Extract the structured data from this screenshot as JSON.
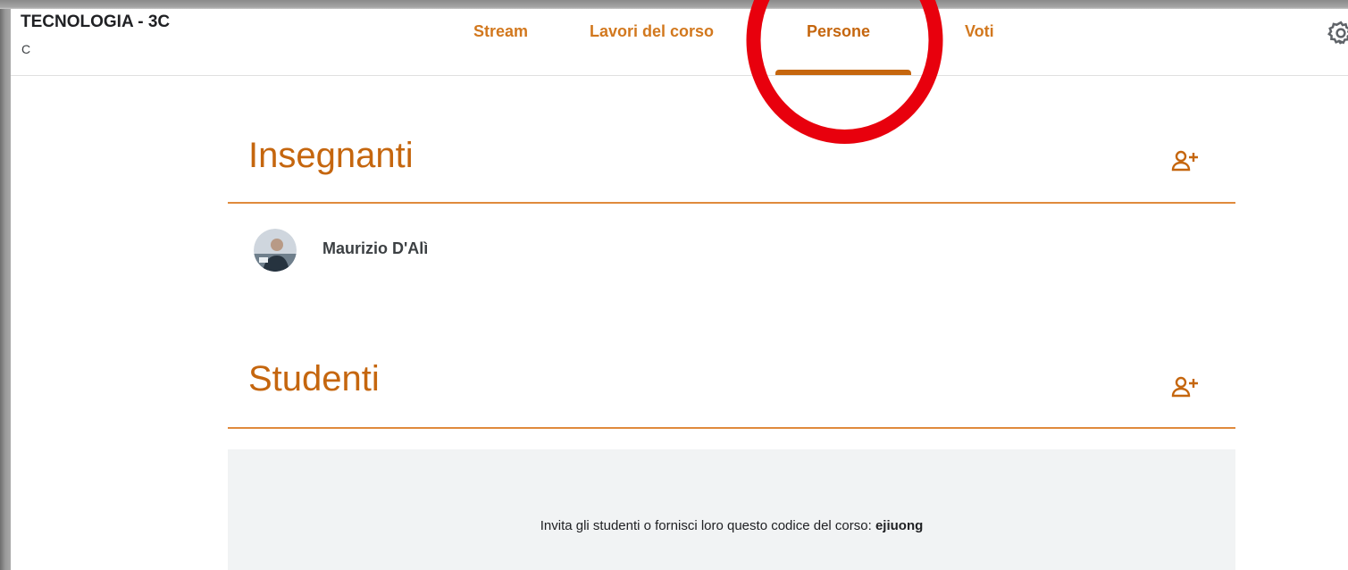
{
  "class": {
    "title": "TECNOLOGIA - 3C",
    "section": "C"
  },
  "tabs": [
    {
      "label": "Stream"
    },
    {
      "label": "Lavori del corso"
    },
    {
      "label": "Persone",
      "active": true
    },
    {
      "label": "Voti"
    }
  ],
  "header": {
    "settings_icon": "gear-icon"
  },
  "teachers": {
    "title": "Insegnanti",
    "add_icon": "person-add-icon",
    "list": [
      {
        "name": "Maurizio D'Alì"
      }
    ]
  },
  "students": {
    "title": "Studenti",
    "add_icon": "person-add-icon",
    "invite_text": "Invita gli studenti o fornisci loro questo codice del corso: ",
    "class_code": "ejiuong"
  },
  "annotation": {
    "type": "circle",
    "target": "Persone",
    "color": "#e8000d"
  },
  "colors": {
    "accent": "#c5660e",
    "tab_text": "#d2781e",
    "divider": "#e08a3c",
    "invite_bg": "#f1f3f4"
  }
}
